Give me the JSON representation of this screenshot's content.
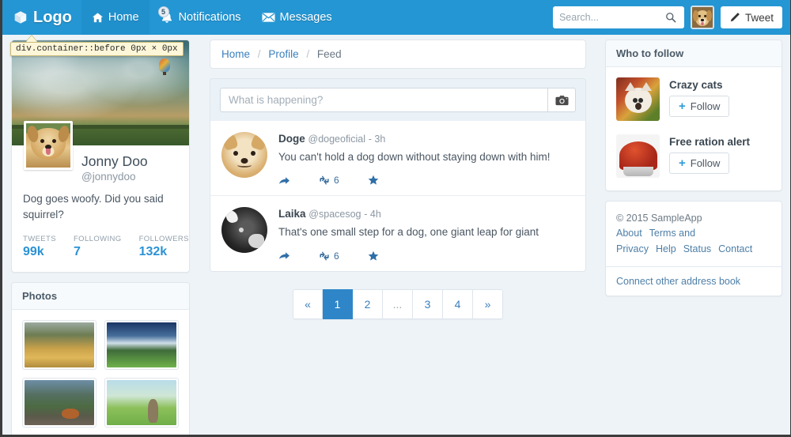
{
  "navbar": {
    "brand": "Logo",
    "brand_icon": "cube-icon",
    "items": [
      {
        "label": "Home",
        "icon": "home-icon",
        "active": true
      },
      {
        "label": "Notifications",
        "icon": "bell-icon",
        "badge": "5",
        "active": false
      },
      {
        "label": "Messages",
        "icon": "envelope-icon",
        "active": false
      }
    ],
    "search_placeholder": "Search...",
    "search_value": "",
    "search_icon": "magnifier-icon",
    "avatar_alt": "user-avatar",
    "tweet_label": "Tweet",
    "tweet_icon": "pencil-icon",
    "bg_color": "#2496d3"
  },
  "inspector": {
    "tooltip": "div.container::before 0px × 0px",
    "selector": "div.container::before",
    "size": "0px × 0px"
  },
  "profile": {
    "name": "Jonny Doo",
    "handle": "@jonnydoo",
    "bio": "Dog goes woofy. Did you said squirrel?",
    "stats": [
      {
        "label": "TWEETS",
        "value": "99k"
      },
      {
        "label": "FOLLOWING",
        "value": "7"
      },
      {
        "label": "FOLLOWERS",
        "value": "132k"
      }
    ],
    "accent_color": "#2b92d4"
  },
  "photos": {
    "title": "Photos",
    "items": [
      {
        "alt": "golden-hills-landscape"
      },
      {
        "alt": "snowy-mountain-meadow"
      },
      {
        "alt": "fox-on-mountain-ridge"
      },
      {
        "alt": "marmot-by-the-lake"
      }
    ]
  },
  "breadcrumb": {
    "items": [
      {
        "label": "Home",
        "link": true
      },
      {
        "label": "Profile",
        "link": true
      },
      {
        "label": "Feed",
        "link": false
      }
    ],
    "separator": "/"
  },
  "composer": {
    "placeholder": "What is happening?",
    "value": "",
    "camera_icon": "camera-icon"
  },
  "feed": {
    "posts": [
      {
        "author": "Doge",
        "handle": "@dogeoficial",
        "time": "- 3h",
        "text": "You can't hold a dog down without staying down with him!",
        "actions": {
          "reply": "",
          "retweet_count": "6",
          "favorite": ""
        }
      },
      {
        "author": "Laika",
        "handle": "@spacesog",
        "time": "- 4h",
        "text": "That's one small step for a dog, one giant leap for giant",
        "actions": {
          "reply": "",
          "retweet_count": "6",
          "favorite": ""
        }
      }
    ]
  },
  "pagination": {
    "prev": "«",
    "next": "»",
    "pages": [
      "1",
      "2",
      "...",
      "3",
      "4"
    ],
    "active": "1",
    "active_color": "#2e86c8"
  },
  "who_to_follow": {
    "title": "Who to follow",
    "entries": [
      {
        "name": "Crazy cats",
        "button": "Follow",
        "avatar_alt": "cat-avatar"
      },
      {
        "name": "Free ration alert",
        "button": "Follow",
        "avatar_alt": "dog-food-avatar"
      }
    ]
  },
  "footer": {
    "copyright": "© 2015 SampleApp",
    "links": [
      "About",
      "Terms and Privacy",
      "Help",
      "Status",
      "Contact"
    ],
    "connect_link": "Connect other address book"
  }
}
